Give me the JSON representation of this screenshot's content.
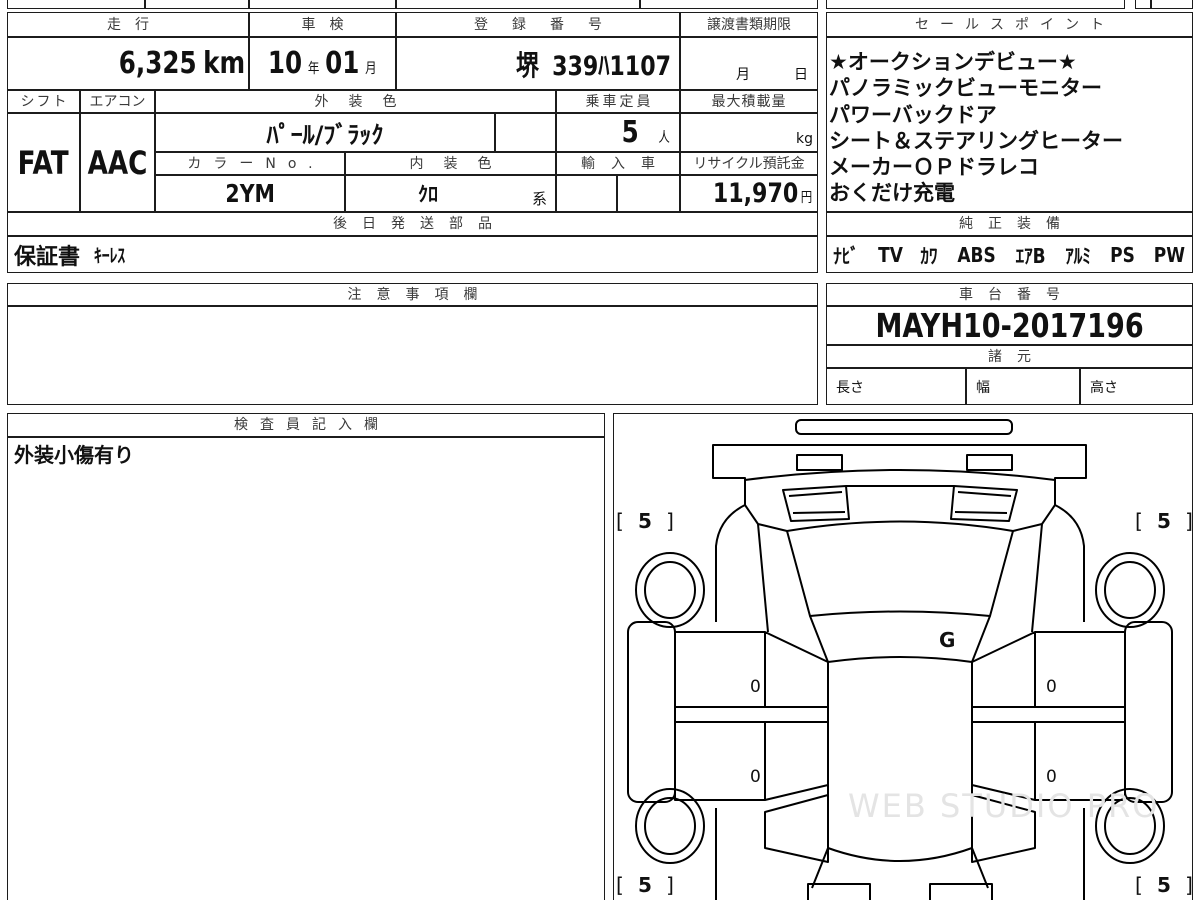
{
  "vehicle": {
    "mileage": {
      "label": "走行",
      "value": "6,325",
      "unit": "km"
    },
    "inspection": {
      "label": "車検",
      "year": "10",
      "year_unit": "年",
      "month": "01",
      "month_unit": "月"
    },
    "registration": {
      "label": "登録番号",
      "region": "堺",
      "number": "339ﾊ1107"
    },
    "transfer_deadline": {
      "label": "譲渡書類期限",
      "month_unit": "月",
      "day_unit": "日"
    },
    "shift": {
      "label": "シフト",
      "value": "FAT"
    },
    "aircon": {
      "label": "エアコン",
      "value": "AAC"
    },
    "exterior_color": {
      "label": "外装色",
      "value": "ﾊﾟｰﾙ/ﾌﾞﾗｯｸ"
    },
    "capacity": {
      "label": "乗車定員",
      "value": "5",
      "unit": "人"
    },
    "max_load": {
      "label": "最大積載量",
      "unit": "kg"
    },
    "color_no": {
      "label": "カラーNo.",
      "value": "2YM"
    },
    "interior_color": {
      "label": "内装色",
      "value": "ｸﾛ",
      "suffix": "系"
    },
    "import": {
      "label": "輸入車"
    },
    "recycle_fee": {
      "label": "リサイクル預託金",
      "value": "11,970",
      "unit": "円"
    },
    "later_parts": {
      "label": "後日発送部品",
      "items": [
        "保証書",
        "ｷｰﾚｽ"
      ]
    }
  },
  "sales_points": {
    "label": "セールスポイント",
    "items": [
      "★オークションデビュー★",
      "パノラミックビューモニター",
      "パワーバックドア",
      "シート＆ステアリングヒーター",
      "メーカーＯＰドラレコ",
      "おくだけ充電"
    ]
  },
  "equipment": {
    "label": "純正装備",
    "items": [
      "ﾅﾋﾞ",
      "TV",
      "ｶﾜ",
      "ABS",
      "ｴｱB",
      "ｱﾙﾐ",
      "PS",
      "PW"
    ]
  },
  "notes": {
    "label": "注意事項欄"
  },
  "chassis": {
    "label": "車台番号",
    "value": "MAYH10-2017196",
    "specs_label": "諸元",
    "length_label": "長さ",
    "width_label": "幅",
    "height_label": "高さ"
  },
  "inspector": {
    "label": "検査員記入欄",
    "comment": "外装小傷有り"
  },
  "diagram": {
    "tires": [
      {
        "open": "[",
        "value": "5",
        "close": "]"
      },
      {
        "open": "[",
        "value": "5",
        "close": "]"
      },
      {
        "open": "[",
        "value": "5",
        "close": "]"
      },
      {
        "open": "[",
        "value": "5",
        "close": "]"
      }
    ],
    "marks": {
      "windshield": "G",
      "left_front_door": "0",
      "left_rear_door": "0",
      "right_front_door": "0",
      "right_rear_door": "0"
    },
    "watermark": "WEB STUDIO PRO"
  }
}
